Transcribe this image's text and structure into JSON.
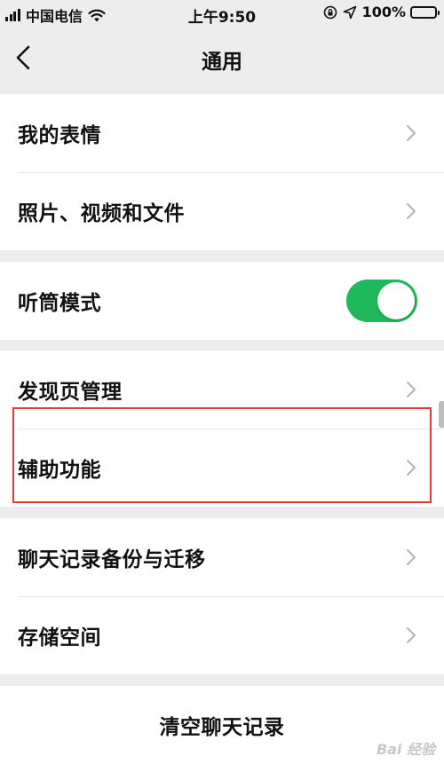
{
  "status_bar": {
    "carrier": "中国电信",
    "time": "上午9:50",
    "battery": "100%",
    "battery_level": 1.0
  },
  "nav": {
    "title": "通用",
    "back_icon": "chevron-left-icon"
  },
  "groups": [
    {
      "items": [
        {
          "label": "我的表情",
          "control": "chevron"
        },
        {
          "label": "照片、视频和文件",
          "control": "chevron"
        }
      ]
    },
    {
      "items": [
        {
          "label": "听筒模式",
          "control": "toggle",
          "toggle_on": true
        }
      ]
    },
    {
      "items": [
        {
          "label": "发现页管理",
          "control": "chevron"
        },
        {
          "label": "辅助功能",
          "control": "chevron",
          "highlighted": true
        }
      ]
    },
    {
      "items": [
        {
          "label": "聊天记录备份与迁移",
          "control": "chevron"
        },
        {
          "label": "存储空间",
          "control": "chevron"
        }
      ]
    }
  ],
  "clear_chat": {
    "label": "清空聊天记录"
  },
  "watermark": {
    "text": "Bai 经验"
  },
  "colors": {
    "toggle_on": "#1fb95c",
    "highlight": "#e03a3a",
    "background": "#ededed"
  }
}
